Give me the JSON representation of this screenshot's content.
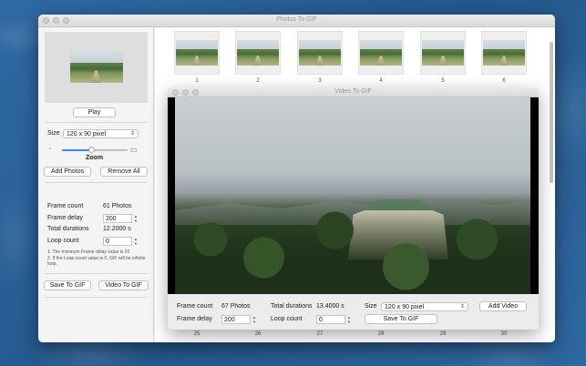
{
  "main_window": {
    "title": "Photos To GIF"
  },
  "sidebar": {
    "play_label": "Play",
    "size_label": "Size",
    "size_value": "120 x 90 pixel",
    "zoom_label": "Zoom",
    "zoom_level": 0.45,
    "add_photos_label": "Add Photos",
    "remove_all_label": "Remove All",
    "frame_count_label": "Frame count",
    "frame_count_value": "61 Photos",
    "frame_delay_label": "Frame delay",
    "frame_delay_value": "200",
    "total_durations_label": "Total durations",
    "total_durations_value": "12.2000 s",
    "loop_count_label": "Loop count",
    "loop_count_value": "0",
    "note_line1": "1. The minimum Frame delay value is 20",
    "note_line2": "2. If the Loop count value is 0, GIF will be infinite loop.",
    "save_to_gif_label": "Save To GIF",
    "video_to_gif_label": "Video To GIF"
  },
  "grid": {
    "top_row": [
      "1",
      "2",
      "3",
      "4",
      "5",
      "6"
    ],
    "bottom_row": [
      "25",
      "26",
      "27",
      "28",
      "29",
      "30"
    ]
  },
  "video_window": {
    "title": "Video To GIF",
    "frame_count_label": "Frame count",
    "frame_count_value": "67 Photos",
    "total_durations_label": "Total durations",
    "total_durations_value": "13.4000 s",
    "size_label": "Size",
    "size_value": "120 x 90 pixel",
    "add_video_label": "Add Video",
    "frame_delay_label": "Frame delay",
    "frame_delay_value": "200",
    "loop_count_label": "Loop count",
    "loop_count_value": "0",
    "save_to_gif_label": "Save To GIF"
  },
  "icons": {
    "stepper": "stepper-icon",
    "chevron": "chevron-updown-icon",
    "zoom_small": "image-small-icon",
    "zoom_large": "image-large-icon"
  },
  "colors": {
    "accent": "#3b82f6",
    "desktop": "#2d5f94"
  }
}
